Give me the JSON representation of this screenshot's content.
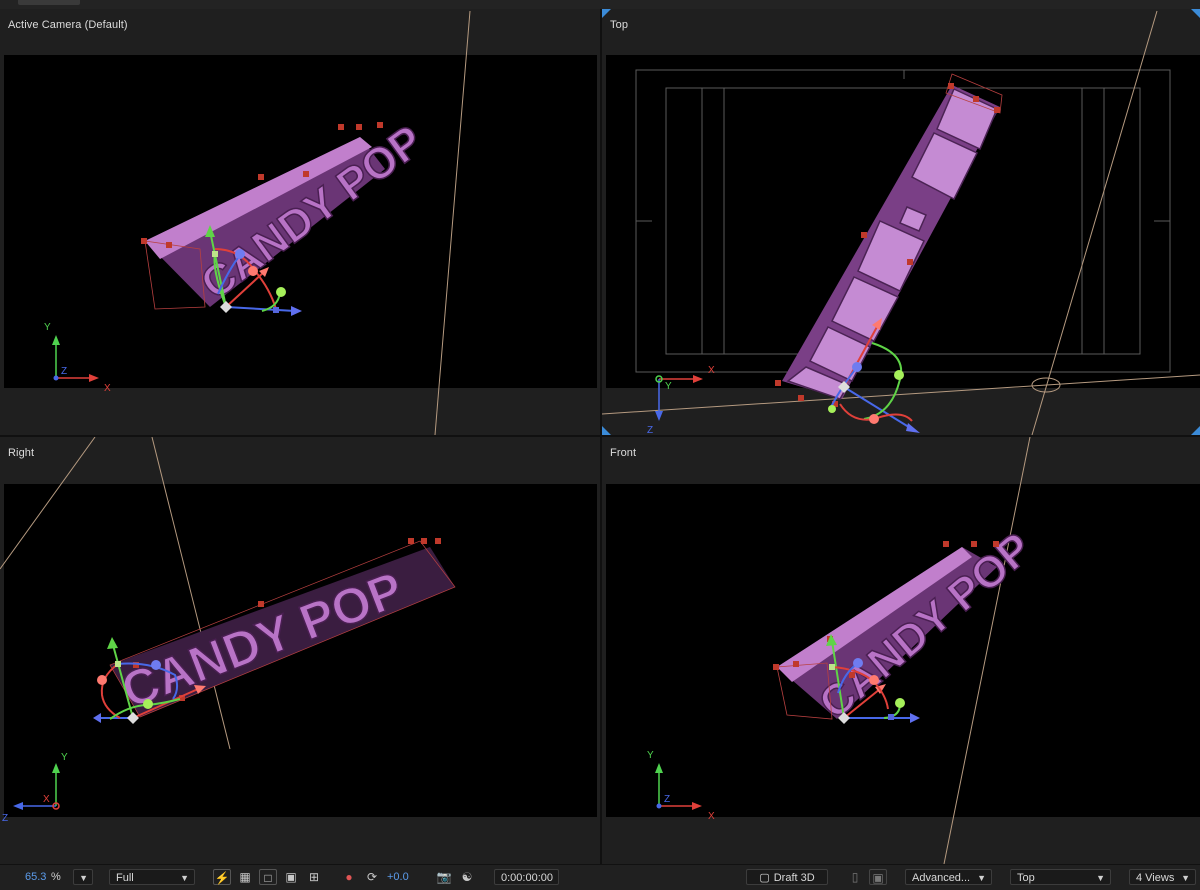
{
  "views": {
    "active_camera": {
      "label": "Active Camera (Default)"
    },
    "top": {
      "label": "Top"
    },
    "right": {
      "label": "Right"
    },
    "front": {
      "label": "Front"
    }
  },
  "scene_text": "CANDY POP",
  "axis_labels": {
    "x": "X",
    "y": "Y",
    "z": "Z"
  },
  "statusbar": {
    "zoom_value": "65.3",
    "zoom_unit": "%",
    "resolution": "Full",
    "exposure": "+0.0",
    "timecode": "0:00:00:00",
    "draft_3d": "Draft 3D",
    "renderer": "Advanced...",
    "view": "Top",
    "layout": "4 Views"
  },
  "colors": {
    "text_fill": "#b873c6",
    "axis_x": "#e0403a",
    "axis_y": "#5fd447",
    "axis_z": "#4868e8",
    "accent_blue": "#5b9bea",
    "handle": "#c0392b"
  }
}
